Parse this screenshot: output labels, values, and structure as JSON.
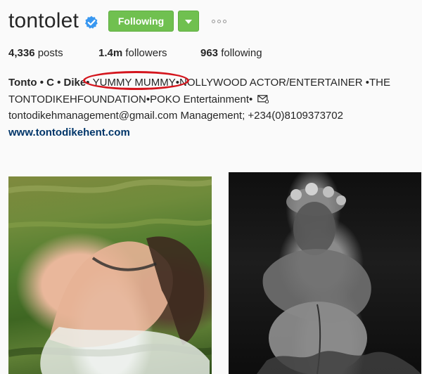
{
  "profile": {
    "username": "tontolet",
    "verified_icon": "verified-badge-icon",
    "following_label": "Following",
    "dropdown_icon": "caret-down-icon",
    "more_icon": "more-options-icon"
  },
  "stats": {
    "posts_count": "4,336",
    "posts_label": "posts",
    "followers_count": "1.4m",
    "followers_label": "followers",
    "following_count": "963",
    "following_label": "following"
  },
  "bio": {
    "name": "Tonto • C • Dike",
    "separator_before_yummy": "•",
    "yummy": "YUMMY MUMMY",
    "separator_after_yummy": "•",
    "line1_rest": "NOLLYWOOD ACTOR/ENTERTAINER •THE",
    "line2": "TONTODIKEHFOUNDATION•POKO Entertainment•",
    "mail_icon": "mail-icon",
    "line3": "tontodikehmanagement@gmail.com Management; +234(0)8109373702",
    "website": "www.tontodikehent.com"
  },
  "theme": {
    "follow_green": "#70c050",
    "verified_blue": "#3897f0",
    "annotation_red": "#d4151d",
    "link_color": "#003569"
  }
}
